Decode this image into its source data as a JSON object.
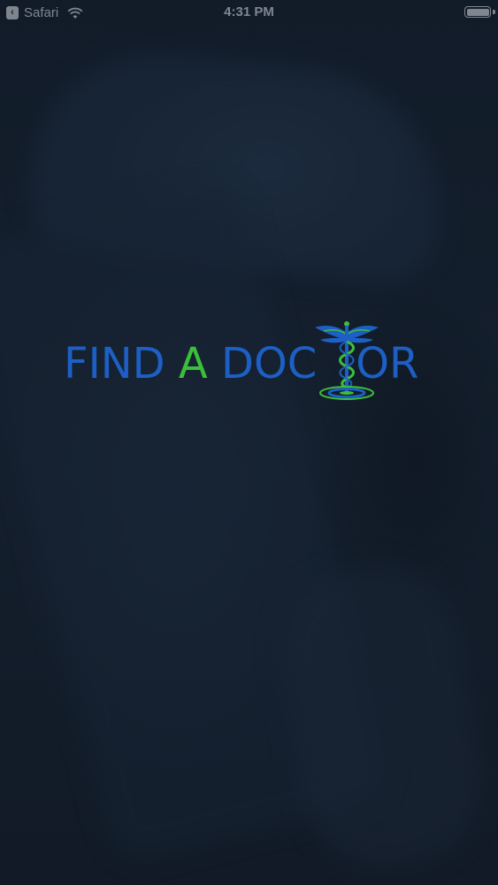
{
  "status_bar": {
    "back_app_label": "Safari",
    "time": "4:31 PM",
    "icons": [
      "back-arrow-icon",
      "wifi-icon",
      "battery-icon"
    ]
  },
  "logo": {
    "part1": "FIND ",
    "part2": "A",
    "part3": " DOC",
    "part4": "OR",
    "icon": "caduceus-icon",
    "colors": {
      "primary_blue": "#1d5fc4",
      "accent_green": "#3bbf3a"
    }
  }
}
